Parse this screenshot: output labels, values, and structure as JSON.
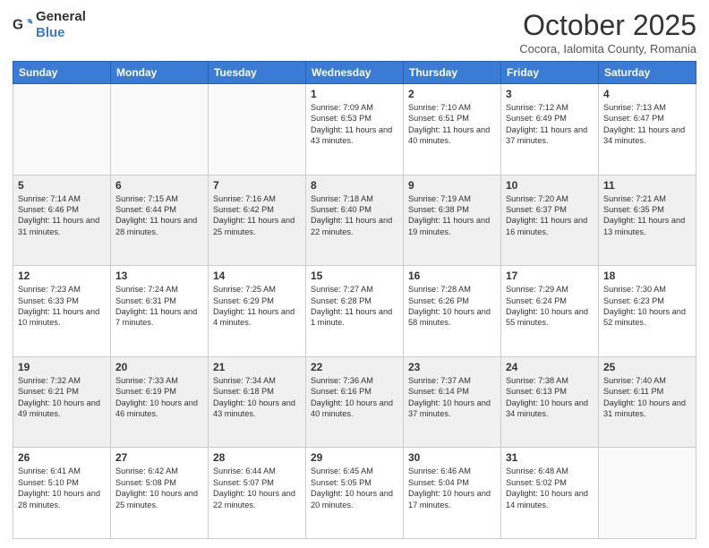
{
  "logo": {
    "general": "General",
    "blue": "Blue"
  },
  "header": {
    "month": "October 2025",
    "subtitle": "Cocora, Ialomita County, Romania"
  },
  "days_of_week": [
    "Sunday",
    "Monday",
    "Tuesday",
    "Wednesday",
    "Thursday",
    "Friday",
    "Saturday"
  ],
  "weeks": [
    [
      {
        "day": "",
        "content": ""
      },
      {
        "day": "",
        "content": ""
      },
      {
        "day": "",
        "content": ""
      },
      {
        "day": "1",
        "content": "Sunrise: 7:09 AM\nSunset: 6:53 PM\nDaylight: 11 hours and 43 minutes."
      },
      {
        "day": "2",
        "content": "Sunrise: 7:10 AM\nSunset: 6:51 PM\nDaylight: 11 hours and 40 minutes."
      },
      {
        "day": "3",
        "content": "Sunrise: 7:12 AM\nSunset: 6:49 PM\nDaylight: 11 hours and 37 minutes."
      },
      {
        "day": "4",
        "content": "Sunrise: 7:13 AM\nSunset: 6:47 PM\nDaylight: 11 hours and 34 minutes."
      }
    ],
    [
      {
        "day": "5",
        "content": "Sunrise: 7:14 AM\nSunset: 6:46 PM\nDaylight: 11 hours and 31 minutes."
      },
      {
        "day": "6",
        "content": "Sunrise: 7:15 AM\nSunset: 6:44 PM\nDaylight: 11 hours and 28 minutes."
      },
      {
        "day": "7",
        "content": "Sunrise: 7:16 AM\nSunset: 6:42 PM\nDaylight: 11 hours and 25 minutes."
      },
      {
        "day": "8",
        "content": "Sunrise: 7:18 AM\nSunset: 6:40 PM\nDaylight: 11 hours and 22 minutes."
      },
      {
        "day": "9",
        "content": "Sunrise: 7:19 AM\nSunset: 6:38 PM\nDaylight: 11 hours and 19 minutes."
      },
      {
        "day": "10",
        "content": "Sunrise: 7:20 AM\nSunset: 6:37 PM\nDaylight: 11 hours and 16 minutes."
      },
      {
        "day": "11",
        "content": "Sunrise: 7:21 AM\nSunset: 6:35 PM\nDaylight: 11 hours and 13 minutes."
      }
    ],
    [
      {
        "day": "12",
        "content": "Sunrise: 7:23 AM\nSunset: 6:33 PM\nDaylight: 11 hours and 10 minutes."
      },
      {
        "day": "13",
        "content": "Sunrise: 7:24 AM\nSunset: 6:31 PM\nDaylight: 11 hours and 7 minutes."
      },
      {
        "day": "14",
        "content": "Sunrise: 7:25 AM\nSunset: 6:29 PM\nDaylight: 11 hours and 4 minutes."
      },
      {
        "day": "15",
        "content": "Sunrise: 7:27 AM\nSunset: 6:28 PM\nDaylight: 11 hours and 1 minute."
      },
      {
        "day": "16",
        "content": "Sunrise: 7:28 AM\nSunset: 6:26 PM\nDaylight: 10 hours and 58 minutes."
      },
      {
        "day": "17",
        "content": "Sunrise: 7:29 AM\nSunset: 6:24 PM\nDaylight: 10 hours and 55 minutes."
      },
      {
        "day": "18",
        "content": "Sunrise: 7:30 AM\nSunset: 6:23 PM\nDaylight: 10 hours and 52 minutes."
      }
    ],
    [
      {
        "day": "19",
        "content": "Sunrise: 7:32 AM\nSunset: 6:21 PM\nDaylight: 10 hours and 49 minutes."
      },
      {
        "day": "20",
        "content": "Sunrise: 7:33 AM\nSunset: 6:19 PM\nDaylight: 10 hours and 46 minutes."
      },
      {
        "day": "21",
        "content": "Sunrise: 7:34 AM\nSunset: 6:18 PM\nDaylight: 10 hours and 43 minutes."
      },
      {
        "day": "22",
        "content": "Sunrise: 7:36 AM\nSunset: 6:16 PM\nDaylight: 10 hours and 40 minutes."
      },
      {
        "day": "23",
        "content": "Sunrise: 7:37 AM\nSunset: 6:14 PM\nDaylight: 10 hours and 37 minutes."
      },
      {
        "day": "24",
        "content": "Sunrise: 7:38 AM\nSunset: 6:13 PM\nDaylight: 10 hours and 34 minutes."
      },
      {
        "day": "25",
        "content": "Sunrise: 7:40 AM\nSunset: 6:11 PM\nDaylight: 10 hours and 31 minutes."
      }
    ],
    [
      {
        "day": "26",
        "content": "Sunrise: 6:41 AM\nSunset: 5:10 PM\nDaylight: 10 hours and 28 minutes."
      },
      {
        "day": "27",
        "content": "Sunrise: 6:42 AM\nSunset: 5:08 PM\nDaylight: 10 hours and 25 minutes."
      },
      {
        "day": "28",
        "content": "Sunrise: 6:44 AM\nSunset: 5:07 PM\nDaylight: 10 hours and 22 minutes."
      },
      {
        "day": "29",
        "content": "Sunrise: 6:45 AM\nSunset: 5:05 PM\nDaylight: 10 hours and 20 minutes."
      },
      {
        "day": "30",
        "content": "Sunrise: 6:46 AM\nSunset: 5:04 PM\nDaylight: 10 hours and 17 minutes."
      },
      {
        "day": "31",
        "content": "Sunrise: 6:48 AM\nSunset: 5:02 PM\nDaylight: 10 hours and 14 minutes."
      },
      {
        "day": "",
        "content": ""
      }
    ]
  ]
}
